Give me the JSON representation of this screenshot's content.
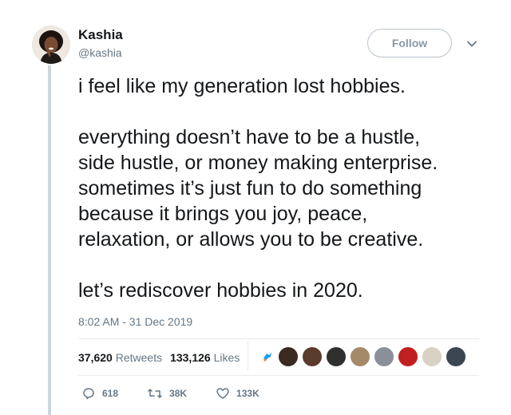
{
  "author": {
    "name": "Kashia",
    "handle": "@kashia"
  },
  "follow_label": "Follow",
  "tweet": {
    "lines_p1": [
      "i feel like my generation lost hobbies."
    ],
    "lines_p2": [
      "everything doesn’t have to be a hustle,",
      "side hustle, or money making enterprise.",
      "sometimes it’s just fun to do something",
      "because it brings you joy, peace,",
      "relaxation, or allows you to be creative."
    ],
    "lines_p3": [
      "let’s rediscover hobbies in 2020."
    ]
  },
  "timestamp": "8:02 AM - 31 Dec 2019",
  "stats": {
    "retweets_count": "37,620",
    "retweets_label": "Retweets",
    "likes_count": "133,126",
    "likes_label": "Likes"
  },
  "likers": [
    {
      "icon": "liker-avatar",
      "color": "#3a2a22"
    },
    {
      "icon": "liker-avatar",
      "color": "#5a3b2c"
    },
    {
      "icon": "liker-avatar",
      "color": "#2f2f2f"
    },
    {
      "icon": "liker-avatar",
      "color": "#a58a6a"
    },
    {
      "icon": "liker-avatar",
      "color": "#8a8f99"
    },
    {
      "icon": "liker-avatar",
      "color": "#c0201f"
    },
    {
      "icon": "liker-avatar",
      "color": "#d8d2c4"
    },
    {
      "icon": "liker-avatar",
      "color": "#3b4652"
    }
  ],
  "actions": {
    "reply_count": "618",
    "retweet_count": "38K",
    "like_count": "133K"
  },
  "colors": {
    "text": "#14171a",
    "muted": "#657786",
    "border": "#e6ecf0",
    "follow_border": "#b7c3cc"
  }
}
